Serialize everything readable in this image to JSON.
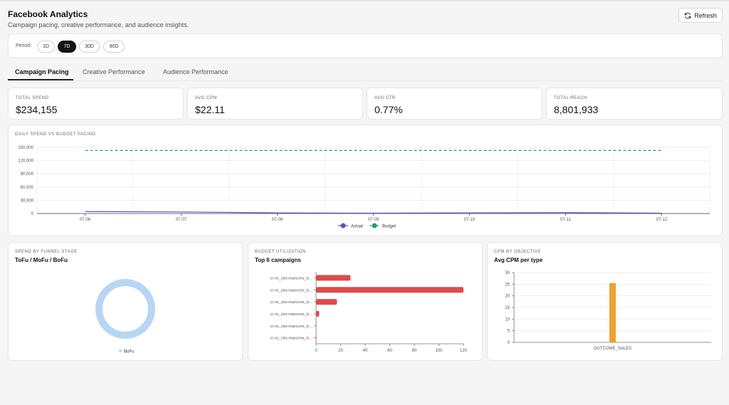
{
  "header": {
    "title": "Facebook Analytics",
    "subtitle": "Campaign pacing, creative performance, and audience insights.",
    "refresh_label": "Refresh"
  },
  "period": {
    "label": "Period:",
    "options": [
      "1D",
      "7D",
      "30D",
      "90D"
    ],
    "selected": "7D"
  },
  "tabs": [
    {
      "label": "Campaign Pacing",
      "active": true
    },
    {
      "label": "Creative Performance",
      "active": false
    },
    {
      "label": "Audience Performance",
      "active": false
    }
  ],
  "kpis": [
    {
      "label": "TOTAL SPEND",
      "value": "$234,155"
    },
    {
      "label": "AVG CPM",
      "value": "$22.11"
    },
    {
      "label": "AVG CTR",
      "value": "0.77%"
    },
    {
      "label": "TOTAL REACH",
      "value": "8,801,933"
    }
  ],
  "colors": {
    "actual": "#5b4fc4",
    "budget": "#1e9e73",
    "donut": "#b8d5f3",
    "bar": "#e04a4a",
    "cpm_bar": "#f0a030"
  },
  "chart_data": [
    {
      "type": "line",
      "title": "DAILY SPEND VS BUDGET PACING",
      "x": [
        "07-06",
        "07-07",
        "07-08",
        "07-09",
        "07-10",
        "07-11",
        "07-12"
      ],
      "series": [
        {
          "name": "Actual",
          "values": [
            4500,
            3500,
            1500,
            800,
            1500,
            2000,
            800
          ]
        },
        {
          "name": "Budget",
          "values": [
            143000,
            143000,
            143000,
            143000,
            143000,
            143000,
            143000
          ]
        }
      ],
      "yticks": [
        "0",
        "30,000",
        "60,000",
        "90,000",
        "120,000",
        "150,000"
      ],
      "ylim": [
        0,
        150000
      ],
      "legend": "bottom"
    },
    {
      "type": "pie",
      "title": "SPEND BY FUNNEL STAGE",
      "subtitle": "ToFu / MoFu / BoFu",
      "categories": [
        "BoFu"
      ],
      "values": [
        100
      ],
      "legend": "bottom"
    },
    {
      "type": "bar",
      "orientation": "horizontal",
      "title": "BUDGET UTILIZATION",
      "subtitle": "Top 6 campaigns",
      "categories": [
        "cr-nc_cbo-maxconv_lc...",
        "cr-nc_cbo-maxconv_lc...",
        "cr-nc_cbo-maxconv_lc...",
        "cr-nc_cbo-maxconv_lc...",
        "cr-nc_cbo-maxconv_lc...",
        "cr-nc_cbo-maxconv_lc..."
      ],
      "values": [
        28,
        120,
        17,
        2.5,
        0.3,
        0.3
      ],
      "xticks": [
        "0",
        "20",
        "40",
        "60",
        "80",
        "100",
        "120"
      ],
      "xlim": [
        0,
        120
      ]
    },
    {
      "type": "bar",
      "title": "CPM BY OBJECTIVE",
      "subtitle": "Avg CPM per type",
      "categories": [
        "OUTCOME_SALES"
      ],
      "values": [
        25.5
      ],
      "yticks": [
        "0",
        "5",
        "10",
        "15",
        "20",
        "25",
        "30"
      ],
      "ylim": [
        0,
        30
      ]
    }
  ]
}
